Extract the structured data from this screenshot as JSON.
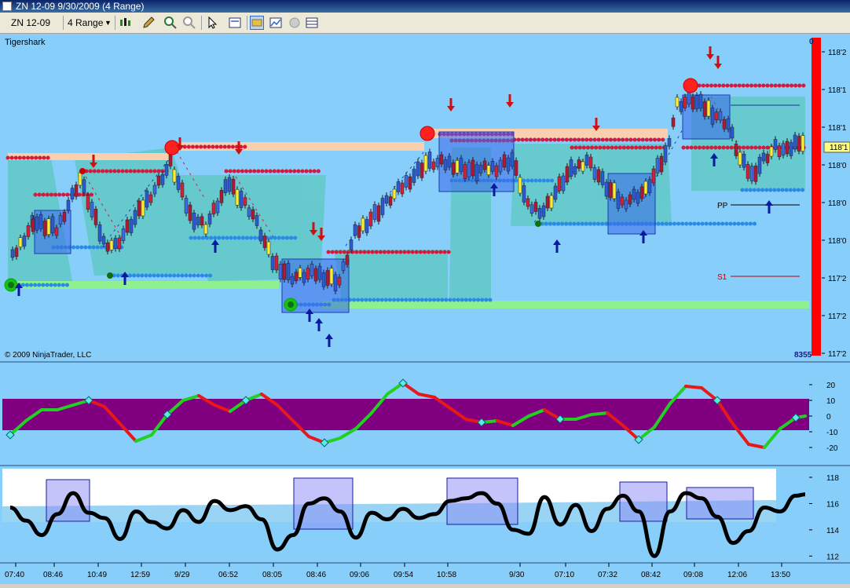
{
  "window": {
    "title": "ZN 12-09  9/30/2009 (4 Range)"
  },
  "toolbar": {
    "instrument": "ZN 12-09",
    "period": "4 Range"
  },
  "chart_data": [
    {
      "type": "candlestick",
      "indicator_label": "Tigershark",
      "copyright": "© 2009 NinjaTrader, LLC",
      "price_ticks": [
        "118'2",
        "118'1",
        "118'1",
        "118'0",
        "118'0",
        "118'0",
        "117'2",
        "117'2",
        "117'2"
      ],
      "top_tick": "0",
      "current_price": "118'1",
      "bottom_value": "8355",
      "level_labels": {
        "pivot": "PP",
        "support": "S1"
      }
    },
    {
      "type": "line",
      "y_ticks": [
        "20",
        "10",
        "0",
        "-10",
        "-20"
      ],
      "ylim": [
        -25,
        25
      ],
      "band": [
        -8,
        8
      ],
      "x": [
        0,
        20,
        40,
        60,
        80,
        100,
        120,
        140,
        160,
        180,
        200,
        220,
        240,
        260,
        280,
        300,
        320,
        340,
        360,
        380,
        400,
        420,
        440,
        460,
        480,
        500,
        520,
        540,
        560,
        580,
        600,
        620,
        640,
        660,
        680,
        700,
        720,
        740,
        760,
        780,
        800,
        820,
        840,
        860,
        880,
        900,
        920,
        940,
        960,
        980,
        1000,
        1012
      ],
      "values": [
        -12,
        -3,
        4,
        4,
        7,
        10,
        6,
        -5,
        -16,
        -12,
        1,
        10,
        13,
        7,
        3,
        10,
        14,
        7,
        -3,
        -13,
        -17,
        -14,
        -8,
        2,
        14,
        21,
        14,
        12,
        5,
        -2,
        -4,
        -3,
        -6,
        0,
        4,
        -2,
        -2,
        1,
        2,
        -6,
        -15,
        -7,
        8,
        19,
        18,
        10,
        -5,
        -18,
        -20,
        -8,
        -1,
        0
      ]
    },
    {
      "type": "line",
      "y_ticks": [
        "118",
        "116",
        "114",
        "112"
      ],
      "ylim": [
        111.6,
        118.6
      ],
      "x": [
        0,
        20,
        40,
        60,
        80,
        100,
        120,
        140,
        160,
        180,
        200,
        220,
        240,
        260,
        280,
        300,
        320,
        340,
        360,
        380,
        400,
        420,
        440,
        460,
        480,
        500,
        520,
        540,
        560,
        580,
        600,
        620,
        640,
        660,
        680,
        700,
        720,
        740,
        760,
        780,
        800,
        820,
        840,
        860,
        880,
        900,
        920,
        940,
        960,
        980,
        1000,
        1012
      ],
      "values": [
        115.7,
        114.7,
        113.6,
        115.2,
        116.8,
        115.3,
        114.9,
        113.3,
        115.4,
        114.6,
        114.1,
        115.5,
        114.6,
        116.2,
        115.5,
        115.8,
        114.8,
        112.5,
        113.6,
        116.0,
        116.4,
        115.4,
        113.4,
        115.3,
        114.8,
        115.6,
        114.9,
        115.2,
        116.2,
        116.4,
        116.8,
        116.0,
        114.0,
        113.7,
        116.5,
        114.4,
        115.9,
        113.9,
        115.6,
        116.6,
        115.4,
        112.0,
        115.4,
        116.8,
        116.4,
        115.0,
        113.0,
        113.9,
        115.7,
        115.4,
        116.6,
        116.7
      ]
    }
  ],
  "time_axis": {
    "labels": [
      "07:40",
      "08:46",
      "10:49",
      "12:59",
      "9/29",
      "06:52",
      "08:05",
      "08:46",
      "09:06",
      "09:54",
      "10:58",
      "9/30",
      "07:10",
      "07:32",
      "08:42",
      "09:08",
      "12:06",
      "13:50"
    ]
  }
}
